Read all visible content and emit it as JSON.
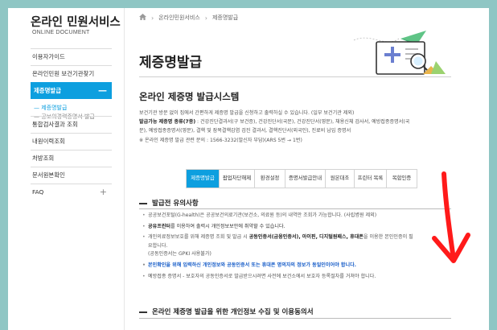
{
  "sidebar": {
    "brand_title": "온라인 민원서비스",
    "brand_subtitle": "ONLINE DOCUMENT",
    "items": [
      {
        "label": "이용자가이드"
      },
      {
        "label": "온라인민원 보건기관찾기"
      },
      {
        "label": "제증명발급",
        "sign": "—"
      },
      {
        "label": "통합검사결과 조회"
      },
      {
        "label": "내원이력조회"
      },
      {
        "label": "처방조회"
      },
      {
        "label": "문서원본확인"
      },
      {
        "label": "FAQ",
        "sign": "+"
      }
    ],
    "sub_items": [
      {
        "label": "제증명발급"
      },
      {
        "label": "공보의경력증명서 발급"
      }
    ]
  },
  "breadcrumb": {
    "home_icon": "home-icon",
    "items": [
      "온라인민원서비스",
      "제증명발급"
    ]
  },
  "page_title": "제증명발급",
  "system_title": "온라인 제증명 발급시스템",
  "description": {
    "line1": "보건기관 방문 없이 집에서 간편하게 제증명 발급을 신청하고 출력하실 수 있습니다. (일부 보건기관 제외)",
    "line2_label": "발급가능 제증명 종류(7종)",
    "line2_text": " : 건강진단결과서(구 보건증), 건강진단서(국문), 건강진단서(영문), 채용신체 검사서, 예방접종증명서(국",
    "line3": "문), 예방접종증명서(영문), 결핵 및 잠복결핵감염 검진 결과서, 결핵진단서(외국인), 진료비 납입 증명서",
    "line4": "※ 온라인 제증명 발급 관련 문의 : 1566-3232(발신자 부담)(ARS 5번 → 1번)"
  },
  "tabs": [
    "제증명발급",
    "팝업차단해제",
    "환경설정",
    "증명서발급안내",
    "원본대조",
    "프린터 목록",
    "복합인증"
  ],
  "section1": {
    "title": "발급전 유의사항",
    "notes": [
      {
        "text": "공공보건포털(G-health)은 공공보건의료기관(보건소, 의료원 등)의 내역만 조회가 가능합니다. (사립병원 제외)"
      },
      {
        "bold": "공유프린터",
        "text": "를 이용하여 출력시 개인정보보안에 취약할 수 있습니다."
      },
      {
        "text": "개인의료정보보호를 위해 제증명 조회 및 발급 시 ",
        "bold": "공동인증서(금융인증서), 아이핀, 디지털원패스, 휴대폰",
        "text2": "을 이용한 본인인증이 필",
        "line2": "요합니다.",
        "line3": "(공동인증서는 GPKI 사용불가)"
      },
      {
        "text": "본인확인을 위해 입력하신 개인정보와 공동인증서 또는 휴대폰 명의자의 정보가 동일인이어야 합니다."
      },
      {
        "text": "예방접종 증명서 - 보호자의 공동인증서로 발급받으시려면 사전에 보건소에서 보호자 등록절차를 거쳐야 합니다."
      }
    ]
  },
  "section2": {
    "title": "온라인 제증명 발급을 위한 개인정보 수집 및 이용동의서"
  },
  "colors": {
    "accent": "#0d9fdf",
    "frame": "#8fc6c4",
    "arrow": "#ff1a1a",
    "notice_blue": "#1a5fc9"
  }
}
